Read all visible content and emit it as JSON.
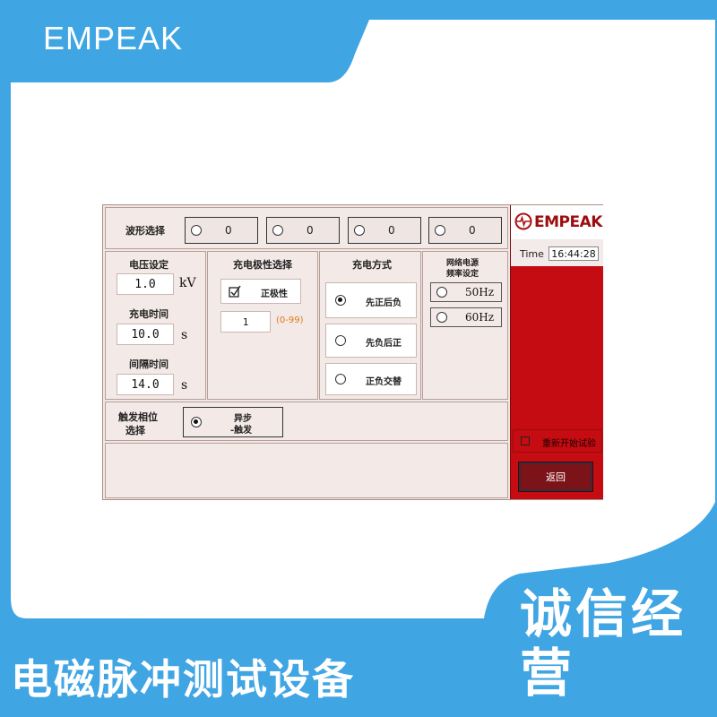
{
  "brand": "EMPEAK",
  "bottom_title": "电磁脉冲测试设备",
  "motto": "诚信经营",
  "colors": {
    "background": "#3fa5e3",
    "side_panel": "#c40c12",
    "accent_orange": "#e07b1a"
  },
  "waveform": {
    "label": "波形选择",
    "options": [
      "0",
      "0",
      "0",
      "0"
    ]
  },
  "voltage": {
    "label": "电压设定",
    "value": "1.0",
    "unit": "kV"
  },
  "charge_time": {
    "label": "充电时间",
    "value": "10.0",
    "unit": "s"
  },
  "interval_time": {
    "label": "间隔时间",
    "value": "14.0",
    "unit": "s"
  },
  "polarity": {
    "label": "充电极性选择",
    "checkbox_label": "正极性",
    "count_value": "1",
    "count_range": "(0-99)"
  },
  "charge_mode": {
    "label": "充电方式",
    "options": [
      {
        "label": "先正后负",
        "selected": true
      },
      {
        "label": "先负后正",
        "selected": false
      },
      {
        "label": "正负交替",
        "selected": false
      }
    ]
  },
  "grid_freq": {
    "label_line1": "网络电源",
    "label_line2": "频率设定",
    "options": [
      "50Hz",
      "60Hz"
    ]
  },
  "trigger_phase": {
    "label_line1": "触发相位",
    "label_line2": "选择",
    "option_line1": "异步",
    "option_line2": "-触发"
  },
  "side": {
    "logo": "EMPEAK",
    "time_label": "Time",
    "time_value": "16:44:28",
    "restart_label": "重新开始试验",
    "back_label": "返回"
  }
}
